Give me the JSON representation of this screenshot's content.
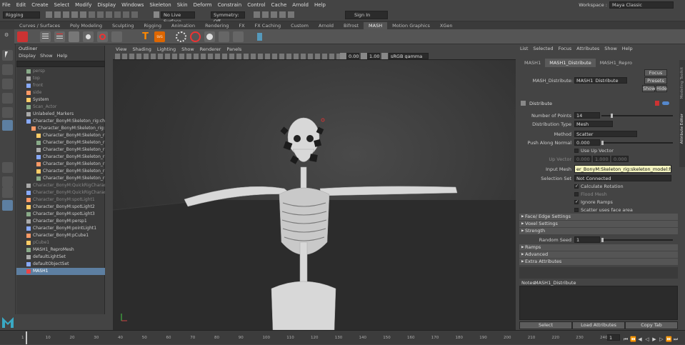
{
  "menubar": {
    "items": [
      "File",
      "Edit",
      "Create",
      "Select",
      "Modify",
      "Display",
      "Windows",
      "Skeleton",
      "Skin",
      "Deform",
      "Constrain",
      "Control",
      "Cache",
      "Arnold",
      "Help"
    ]
  },
  "workspace": {
    "label": "Workspace :",
    "value": "Maya Classic"
  },
  "status": {
    "mode": "Rigging",
    "live": "No Live Surface",
    "symmetry": "Symmetry: Off",
    "signin": "Sign In"
  },
  "shelf": {
    "tabs": [
      "Curves / Surfaces",
      "Poly Modeling",
      "Sculpting",
      "Rigging",
      "Animation",
      "Rendering",
      "FX",
      "FX Caching",
      "Custom",
      "Arnold",
      "Bifrost",
      "MASH",
      "Motion Graphics",
      "XGen"
    ],
    "active": "MASH"
  },
  "outliner": {
    "title": "Outliner",
    "menu": [
      "Display",
      "Show",
      "Help"
    ],
    "rows": [
      {
        "label": "persp",
        "dim": true,
        "ind": 0
      },
      {
        "label": "top",
        "dim": true,
        "ind": 0
      },
      {
        "label": "front",
        "dim": true,
        "ind": 0
      },
      {
        "label": "side",
        "dim": true,
        "ind": 0
      },
      {
        "label": "System",
        "dim": false,
        "ind": 0
      },
      {
        "label": "Scan_Actor",
        "dim": true,
        "ind": 0
      },
      {
        "label": "Unlabeled_Markers",
        "dim": false,
        "ind": 0
      },
      {
        "label": "Character_BonyM:Skeleton_rig:char",
        "dim": false,
        "ind": 0
      },
      {
        "label": "Character_BonyM:Skeleton_rig:ske",
        "dim": false,
        "ind": 1
      },
      {
        "label": "Character_BonyM:Skeleton_rig:s",
        "dim": false,
        "ind": 2
      },
      {
        "label": "Character_BonyM:Skeleton_rig:s",
        "dim": false,
        "ind": 2
      },
      {
        "label": "Character_BonyM:Skeleton_rig:s",
        "dim": false,
        "ind": 2
      },
      {
        "label": "Character_BonyM:Skeleton_rig:s",
        "dim": false,
        "ind": 2
      },
      {
        "label": "Character_BonyM:Skeleton_rig:s",
        "dim": false,
        "ind": 2
      },
      {
        "label": "Character_BonyM:Skeleton_rig:s",
        "dim": false,
        "ind": 2
      },
      {
        "label": "Character_BonyM:Skeleton_rig:s",
        "dim": false,
        "ind": 2
      },
      {
        "label": "Character_BonyM:QuickRigCharacter",
        "dim": true,
        "ind": 0
      },
      {
        "label": "Character_BonyM:QuickRigCharacter",
        "dim": true,
        "ind": 0
      },
      {
        "label": "Character_BonyM:spotLight1",
        "dim": true,
        "ind": 0
      },
      {
        "label": "Character_BonyM:spotLight2",
        "dim": false,
        "ind": 0
      },
      {
        "label": "Character_BonyM:spotLight3",
        "dim": false,
        "ind": 0
      },
      {
        "label": "Character_BonyM:persp1",
        "dim": false,
        "ind": 0
      },
      {
        "label": "Character_BonyM:pointLight1",
        "dim": false,
        "ind": 0
      },
      {
        "label": "Character_BonyM:pCube1",
        "dim": false,
        "ind": 0
      },
      {
        "label": "pCube1",
        "dim": true,
        "ind": 0
      },
      {
        "label": "MASH1_ReproMesh",
        "dim": false,
        "ind": 0
      },
      {
        "label": "defaultLightSet",
        "dim": false,
        "ind": 0
      },
      {
        "label": "defaultObjectSet",
        "dim": false,
        "ind": 0
      },
      {
        "label": "MASH1",
        "dim": false,
        "ind": 0,
        "sel": true
      }
    ]
  },
  "viewport": {
    "menu": [
      "View",
      "Shading",
      "Lighting",
      "Show",
      "Renderer",
      "Panels"
    ],
    "val1": "0.00",
    "val2": "1.00",
    "colorspace": "sRGB gamma"
  },
  "attr": {
    "menu": [
      "List",
      "Selected",
      "Focus",
      "Attributes",
      "Show",
      "Help"
    ],
    "tabs": [
      "MASH1",
      "MASH1_Distribute",
      "MASH1_Repro"
    ],
    "node_label": "MASH_Distribute:",
    "node_value": "MASH1_Distribute",
    "btn_focus": "Focus",
    "btn_presets": "Presets",
    "btn_show": "Show",
    "btn_hide": "Hide",
    "section": "Distribute",
    "num_points_label": "Number of Points",
    "num_points": "14",
    "dist_type_label": "Distribution Type",
    "dist_type": "Mesh",
    "method_label": "Method",
    "method": "Scatter",
    "push_label": "Push Along Normal",
    "push": "0.000",
    "use_up": "Use Up Vector",
    "up_vector_label": "Up Vector",
    "up1": "0.000",
    "up2": "1.000",
    "up3": "0.000",
    "input_mesh_label": "Input Mesh",
    "input_mesh": "er_BonyM:Skeleton_rig:skeleton_model:headShape",
    "sel_set_label": "Selection Set",
    "sel_set": "Not Connected",
    "calc_rot": "Calculate Rotation",
    "flood_mesh": "Flood Mesh",
    "ignore_ramps": "Ignore Ramps",
    "scatter_face": "Scatter uses face area",
    "sections": [
      "Face/ Edge Settings",
      "Voxel Settings",
      "Strength"
    ],
    "random_seed_label": "Random Seed",
    "random_seed": "1",
    "sections2": [
      "Ramps",
      "Advanced",
      "Extra Attributes"
    ],
    "notes_label": "Notes:",
    "notes_value": "MASH1_Distribute",
    "bottom": [
      "Select",
      "Load Attributes",
      "Copy Tab"
    ]
  },
  "sidetabs": [
    "Modeling Toolkit",
    "Attribute Editor"
  ],
  "timeline": {
    "ticks": [
      "1",
      "10",
      "20",
      "30",
      "40",
      "50",
      "60",
      "70",
      "80",
      "90",
      "100",
      "110",
      "120",
      "130",
      "140",
      "150",
      "160",
      "170",
      "180",
      "190",
      "200",
      "210",
      "220",
      "230",
      "240"
    ],
    "current": "1"
  }
}
